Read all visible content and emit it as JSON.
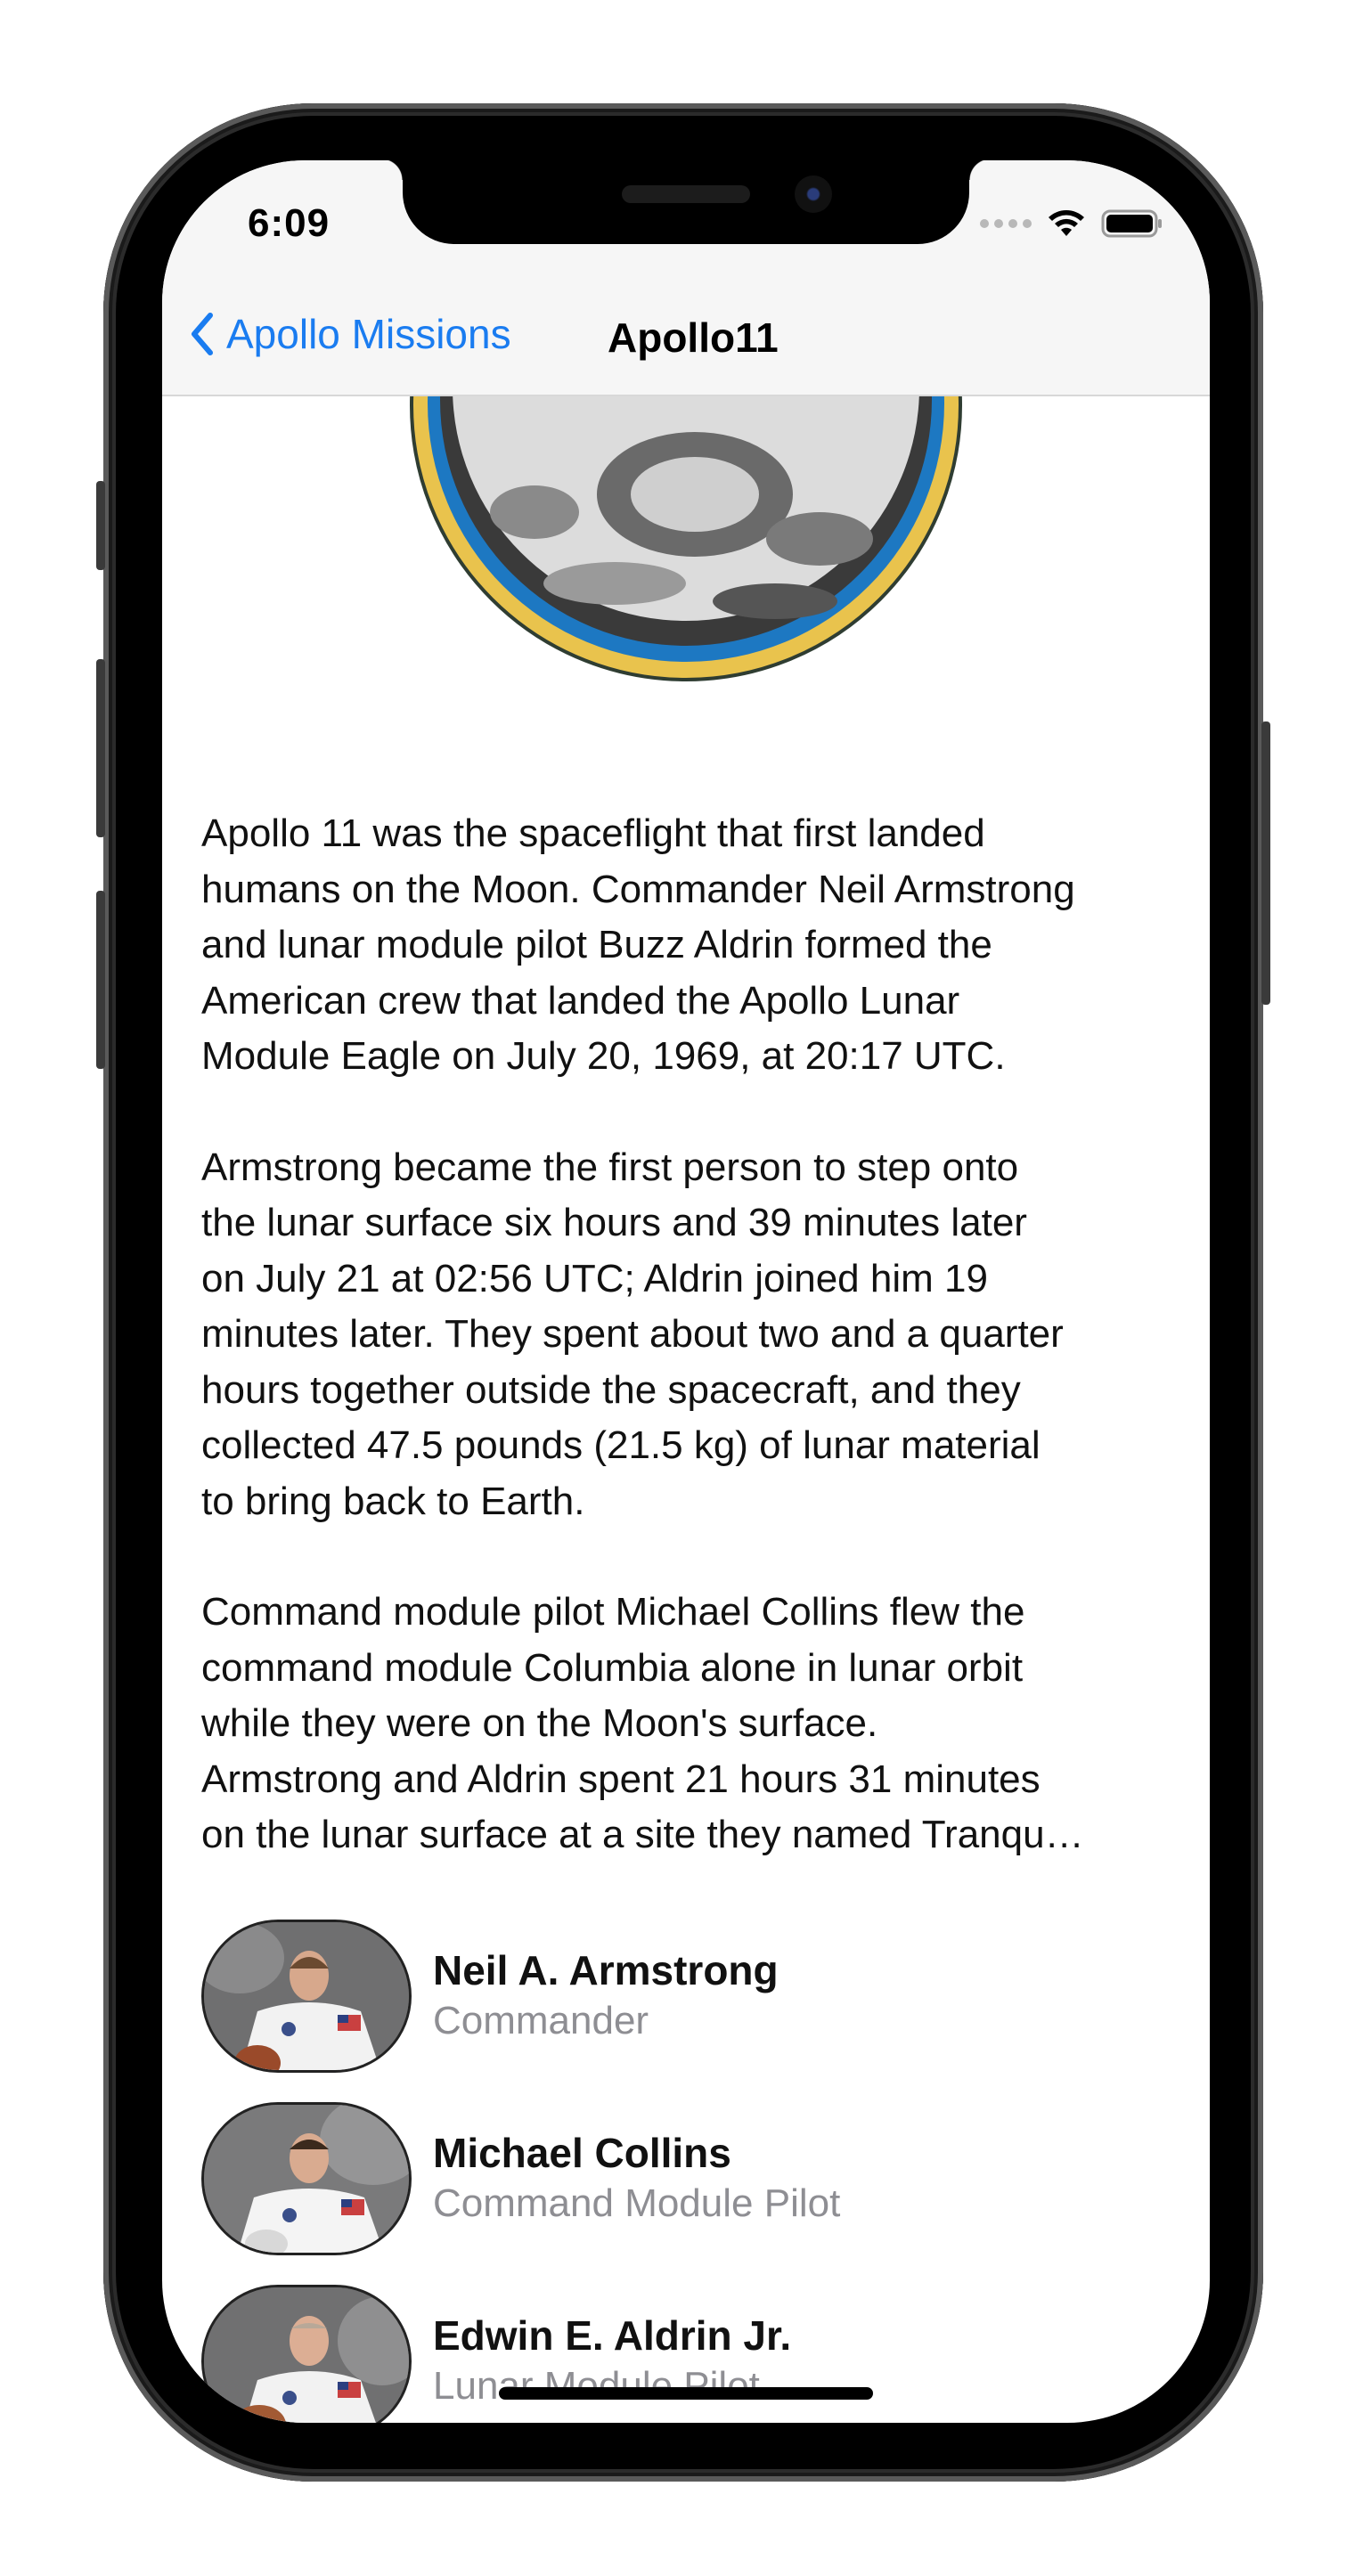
{
  "status_bar": {
    "time": "6:09"
  },
  "nav": {
    "back_label": "Apollo Missions",
    "title": "Apollo11"
  },
  "description": {
    "paragraphs": [
      "Apollo 11 was the spaceflight that first landed\nhumans on the Moon. Commander Neil Armstrong\nand lunar module pilot Buzz Aldrin formed the\nAmerican crew that landed the Apollo Lunar\nModule Eagle on July 20, 1969, at 20:17 UTC.",
      "Armstrong became the first person to step onto\nthe lunar surface six hours and 39 minutes later\non July 21 at 02:56 UTC; Aldrin joined him 19\nminutes later. They spent about two and a quarter\nhours together outside the spacecraft, and they\ncollected 47.5 pounds (21.5 kg) of lunar material\nto bring back to Earth.",
      "Command module pilot Michael Collins flew the\ncommand module Columbia alone in lunar orbit\nwhile they were on the Moon's surface.\nArmstrong and Aldrin spent 21 hours 31 minutes\non the lunar surface at a site they named Tranqu…"
    ]
  },
  "crew": [
    {
      "name": "Neil A. Armstrong",
      "role": "Commander"
    },
    {
      "name": "Michael Collins",
      "role": "Command Module Pilot"
    },
    {
      "name": "Edwin E. Aldrin Jr.",
      "role": "Lunar Module Pilot"
    }
  ],
  "colors": {
    "accent": "#1a7cf0",
    "secondary_text": "#8e8e93"
  },
  "icons": {
    "back": "chevron-left-icon",
    "wifi": "wifi-icon",
    "battery": "battery-icon",
    "signal": "cellular-signal-icon"
  }
}
